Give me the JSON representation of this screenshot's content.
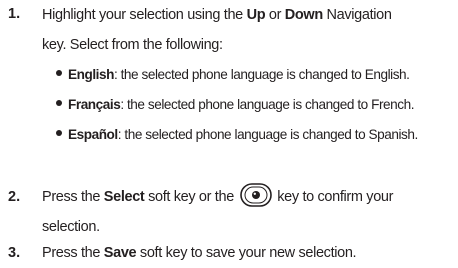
{
  "steps": [
    {
      "number": "1.",
      "line1_pre": "Highlight your selection using the ",
      "line1_bold1": "Up",
      "line1_mid": " or ",
      "line1_bold2": "Down",
      "line1_post": " Navigation",
      "line2": "key. Select from the following:",
      "bullets": [
        {
          "term": "English",
          "desc": ": the selected phone language is changed to English."
        },
        {
          "term": "Français",
          "desc": ": the selected phone language is changed to French."
        },
        {
          "term": "Español",
          "desc": ": the selected phone language is changed to Spanish."
        }
      ]
    },
    {
      "number": "2.",
      "line1_pre": "Press the ",
      "line1_bold": "Select",
      "line1_mid": " soft key or the ",
      "line1_post": " key to confirm your",
      "line2": "selection.",
      "icon": "select-key-icon"
    },
    {
      "number": "3.",
      "line1_pre": "Press the ",
      "line1_bold": "Save",
      "line1_post": " soft key to save your new selection."
    }
  ]
}
